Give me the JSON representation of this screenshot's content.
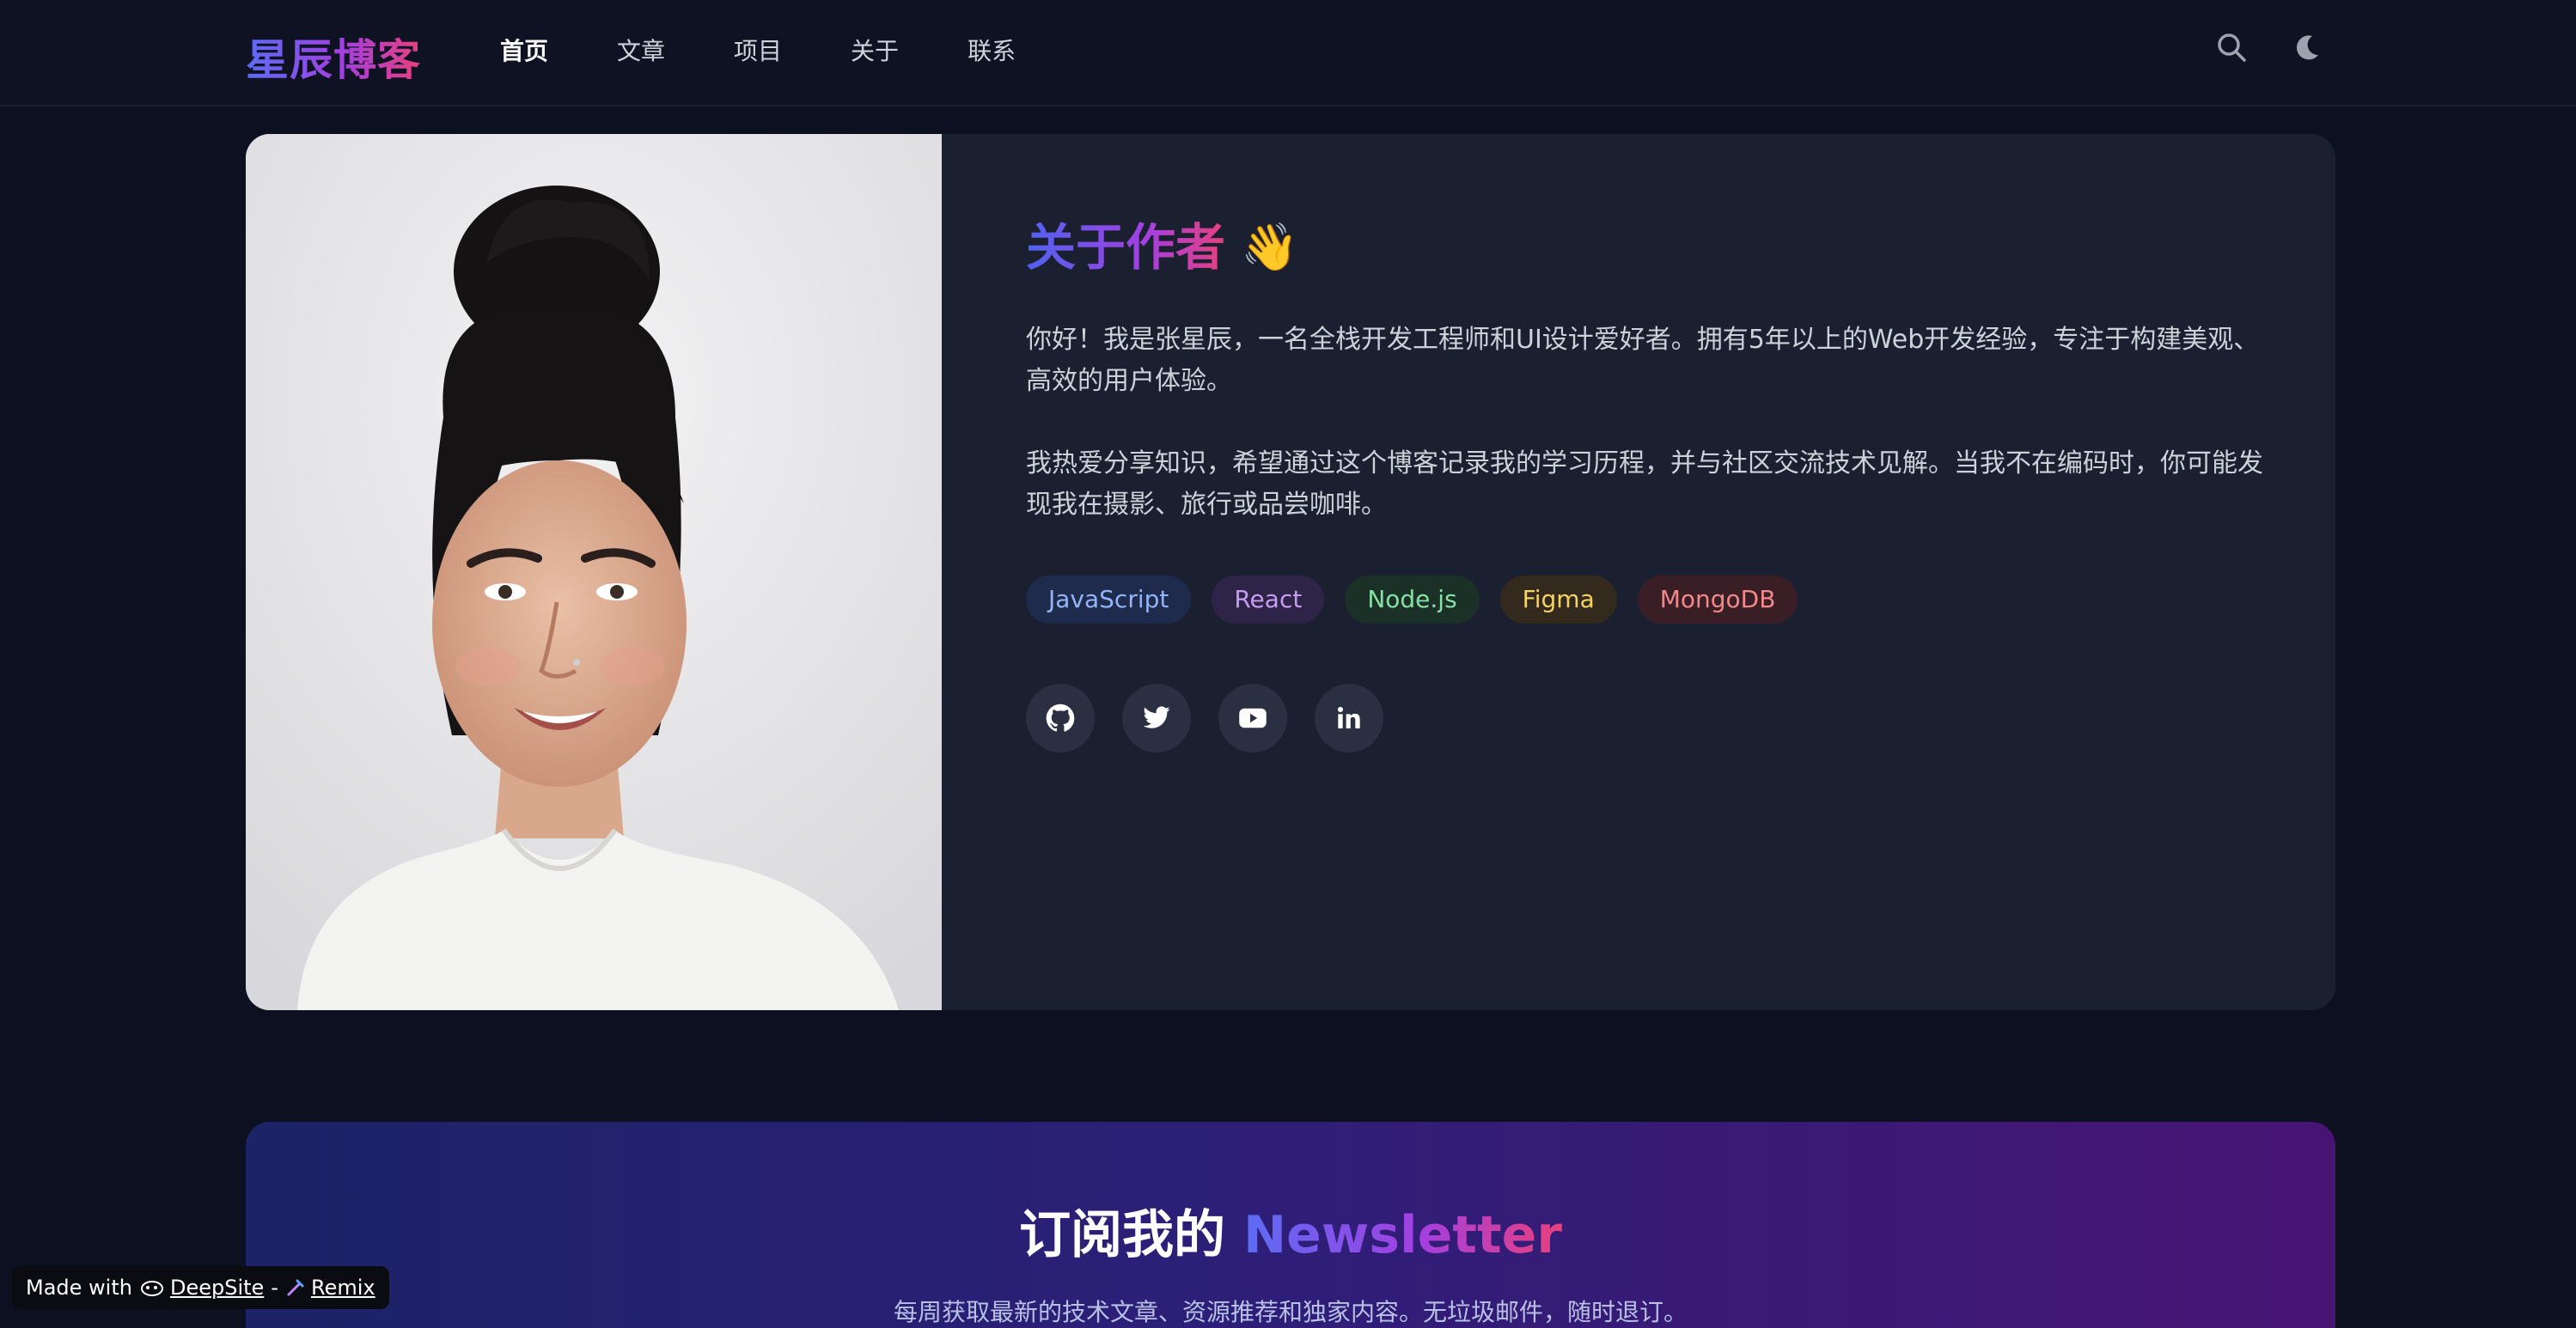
{
  "header": {
    "logo": "星辰博客",
    "nav": [
      "首页",
      "文章",
      "项目",
      "关于",
      "联系"
    ],
    "active_nav": "首页",
    "icons": [
      "search-icon",
      "moon-icon"
    ]
  },
  "about": {
    "title": "关于作者",
    "title_emoji": "👋",
    "para1": "你好！我是张星辰，一名全栈开发工程师和UI设计爱好者。拥有5年以上的Web开发经验，专注于构建美观、高效的用户体验。",
    "para2": "我热爱分享知识，希望通过这个博客记录我的学习历程，并与社区交流技术见解。当我不在编码时，你可能发现我在摄影、旅行或品尝咖啡。",
    "tags": [
      {
        "label": "JavaScript",
        "color": "#93b4f5",
        "bg": "#1f2b4d"
      },
      {
        "label": "React",
        "color": "#c79cf3",
        "bg": "#2d2447"
      },
      {
        "label": "Node.js",
        "color": "#86e0a3",
        "bg": "#1b3027"
      },
      {
        "label": "Figma",
        "color": "#f3d363",
        "bg": "#33291c"
      },
      {
        "label": "MongoDB",
        "color": "#f08a8a",
        "bg": "#3a1e26"
      }
    ],
    "socials": [
      "github-icon",
      "twitter-icon",
      "youtube-icon",
      "linkedin-icon"
    ]
  },
  "newsletter": {
    "title_plain": "订阅我的 ",
    "title_highlight": "Newsletter",
    "subtitle": "每周获取最新的技术文章、资源推荐和独家内容。无垃圾邮件，随时退订。"
  },
  "badge": {
    "prefix": "Made with",
    "link1": "DeepSite",
    "separator": "-",
    "link2": "Remix"
  },
  "colors": {
    "page_bg": "#0d1020",
    "card_bg": "#1b2030",
    "accent_blue": "#5b6cf5",
    "accent_pink": "#e8407c"
  }
}
